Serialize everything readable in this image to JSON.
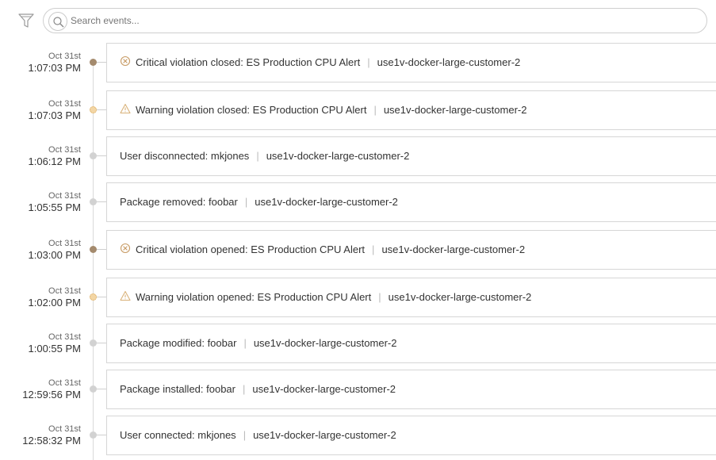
{
  "search": {
    "placeholder": "Search events..."
  },
  "events": [
    {
      "date": "Oct 31st",
      "time": "1:07:03 PM",
      "level": "critical",
      "icon": "critical-x-icon",
      "message": "Critical violation closed: ES Production CPU Alert",
      "host": "use1v-docker-large-customer-2"
    },
    {
      "date": "Oct 31st",
      "time": "1:07:03 PM",
      "level": "warning",
      "icon": "warning-triangle-icon",
      "message": "Warning violation closed: ES Production CPU Alert",
      "host": "use1v-docker-large-customer-2"
    },
    {
      "date": "Oct 31st",
      "time": "1:06:12 PM",
      "level": "info",
      "icon": "",
      "message": "User disconnected: mkjones",
      "host": "use1v-docker-large-customer-2"
    },
    {
      "date": "Oct 31st",
      "time": "1:05:55 PM",
      "level": "info",
      "icon": "",
      "message": "Package removed: foobar",
      "host": "use1v-docker-large-customer-2"
    },
    {
      "date": "Oct 31st",
      "time": "1:03:00 PM",
      "level": "critical",
      "icon": "critical-x-icon",
      "message": "Critical violation opened: ES Production CPU Alert",
      "host": "use1v-docker-large-customer-2"
    },
    {
      "date": "Oct 31st",
      "time": "1:02:00 PM",
      "level": "warning",
      "icon": "warning-triangle-icon",
      "message": "Warning violation opened: ES Production CPU Alert",
      "host": "use1v-docker-large-customer-2"
    },
    {
      "date": "Oct 31st",
      "time": "1:00:55 PM",
      "level": "info",
      "icon": "",
      "message": "Package modified: foobar",
      "host": "use1v-docker-large-customer-2"
    },
    {
      "date": "Oct 31st",
      "time": "12:59:56 PM",
      "level": "info",
      "icon": "",
      "message": "Package installed: foobar",
      "host": "use1v-docker-large-customer-2"
    },
    {
      "date": "Oct 31st",
      "time": "12:58:32 PM",
      "level": "info",
      "icon": "",
      "message": "User connected: mkjones",
      "host": "use1v-docker-large-customer-2"
    }
  ],
  "colors": {
    "critical": "#a48a6d",
    "warning": "#d9a85a",
    "info": "#d2d2d2"
  }
}
